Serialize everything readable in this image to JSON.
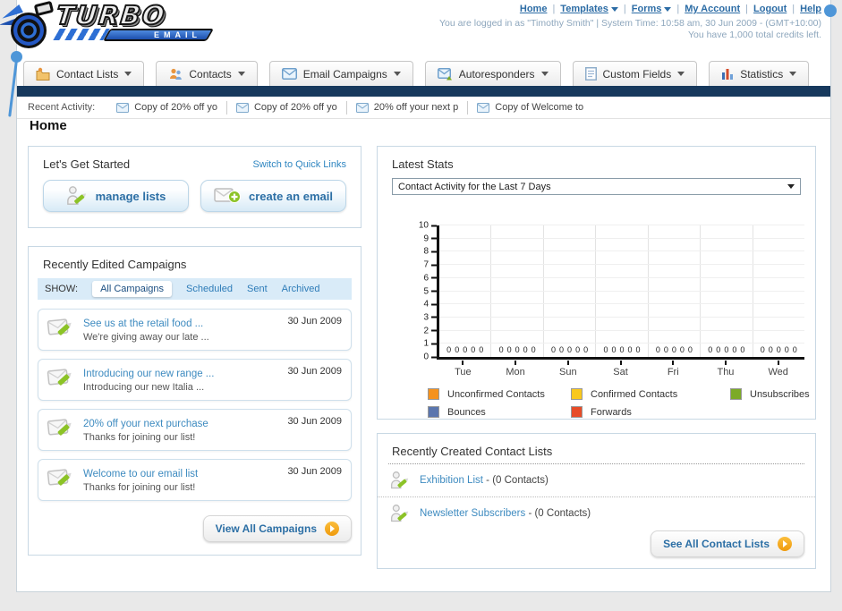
{
  "colors": {
    "navy_bar": "#17395D",
    "link_blue": "#2C6CA5",
    "campaign_link_blue": "#3E8BC0",
    "arrow_orange": "#F29A0D",
    "pin_blue": "#4E96D8",
    "show_strip_bg": "#D9EBF8"
  },
  "header": {
    "logo": {
      "title": "TURBO",
      "subtitle": "EMAIL"
    },
    "nav_links": [
      "Home",
      "Templates",
      "Forms",
      "My Account",
      "Logout",
      "Help"
    ],
    "login_line": "You are logged in as \"Timothy Smith\" | System Time: 10:58 am, 30 Jun 2009 - (GMT+10:00)",
    "credits_line": "You have 1,000 total credits left."
  },
  "nav_tabs": [
    {
      "label": "Contact Lists"
    },
    {
      "label": "Contacts"
    },
    {
      "label": "Email Campaigns"
    },
    {
      "label": "Autoresponders"
    },
    {
      "label": "Custom Fields"
    },
    {
      "label": "Statistics"
    }
  ],
  "recent_activity": {
    "label": "Recent Activity:",
    "items": [
      "Copy of 20% off yo",
      "Copy of 20% off yo",
      "20% off your next p",
      "Copy of Welcome to"
    ]
  },
  "page_title": "Home",
  "get_started": {
    "title": "Let's Get Started",
    "switch_link": "Switch to Quick Links",
    "buttons": [
      {
        "label": "manage lists"
      },
      {
        "label": "create an email"
      }
    ]
  },
  "campaigns": {
    "title": "Recently Edited Campaigns",
    "show_label": "SHOW:",
    "filters": [
      "All Campaigns",
      "Scheduled",
      "Sent",
      "Archived"
    ],
    "active_filter": "All Campaigns",
    "items": [
      {
        "title": "See us at the retail food ...",
        "subtitle": "We're giving away our late ...",
        "date": "30 Jun 2009"
      },
      {
        "title": "Introducing our new range ...",
        "subtitle": "Introducing our new Italia ...",
        "date": "30 Jun 2009"
      },
      {
        "title": "20% off your next purchase",
        "subtitle": "Thanks for joining our list!",
        "date": "30 Jun 2009"
      },
      {
        "title": "Welcome to our email list",
        "subtitle": "Thanks for joining our list!",
        "date": "30 Jun 2009"
      }
    ],
    "view_all_label": "View All Campaigns"
  },
  "latest_stats": {
    "title": "Latest Stats",
    "dropdown_value": "Contact Activity for the Last 7 Days"
  },
  "chart_data": {
    "type": "bar",
    "title": "Contact Activity for the Last 7 Days",
    "categories": [
      "Tue",
      "Mon",
      "Sun",
      "Sat",
      "Fri",
      "Thu",
      "Wed"
    ],
    "series": [
      {
        "name": "Unconfirmed Contacts",
        "color": "#F5921E",
        "values": [
          0,
          0,
          0,
          0,
          0,
          0,
          0
        ]
      },
      {
        "name": "Confirmed Contacts",
        "color": "#F9C81D",
        "values": [
          0,
          0,
          0,
          0,
          0,
          0,
          0
        ]
      },
      {
        "name": "Unsubscribes",
        "color": "#7CAA27",
        "values": [
          0,
          0,
          0,
          0,
          0,
          0,
          0
        ]
      },
      {
        "name": "Bounces",
        "color": "#5B76AE",
        "values": [
          0,
          0,
          0,
          0,
          0,
          0,
          0
        ]
      },
      {
        "name": "Forwards",
        "color": "#E74C28",
        "values": [
          0,
          0,
          0,
          0,
          0,
          0,
          0
        ]
      }
    ],
    "ylim": [
      0,
      10
    ],
    "ytick_step": 1,
    "grid": true,
    "legend_position": "bottom"
  },
  "contact_lists": {
    "title": "Recently Created Contact Lists",
    "items": [
      {
        "name": "Exhibition List",
        "suffix": "- (0 Contacts)"
      },
      {
        "name": "Newsletter Subscribers",
        "suffix": "- (0 Contacts)"
      }
    ],
    "see_all_label": "See All Contact Lists"
  }
}
